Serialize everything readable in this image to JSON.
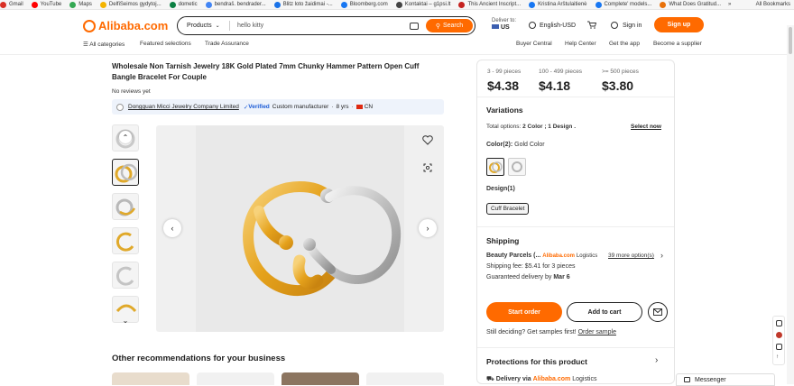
{
  "bookmarks": [
    {
      "label": "Gmail",
      "color": "#d93025"
    },
    {
      "label": "YouTube",
      "color": "#ff0000"
    },
    {
      "label": "Maps",
      "color": "#34a853"
    },
    {
      "label": "DelfiSeimos gydytoj...",
      "color": "#f4b400"
    },
    {
      "label": "dometic",
      "color": "#0b8043"
    },
    {
      "label": "bendraš. bendrader...",
      "color": "#4285f4"
    },
    {
      "label": "Blitz loto žaidimai -...",
      "color": "#1a73e8"
    },
    {
      "label": "Bloomberg.com",
      "color": "#1877f2"
    },
    {
      "label": "Kontaktai – g1psi.lt",
      "color": "#444444"
    },
    {
      "label": "This Ancient Inscript...",
      "color": "#c5221f"
    },
    {
      "label": "Kristina Arštulaitienė",
      "color": "#1877f2"
    },
    {
      "label": "Complete' models...",
      "color": "#1877f2"
    },
    {
      "label": "What Does Gratitud...",
      "color": "#e8710a"
    }
  ],
  "bookmarks_more": "»",
  "bookmarks_all": "All Bookmarks",
  "header": {
    "logo": "Alibaba.com",
    "search_category": "Products",
    "search_query": "hello kitty",
    "search_button": "Search",
    "deliver_to_label": "Deliver to:",
    "deliver_to_country": "US",
    "language": "English-USD",
    "sign_in": "Sign in",
    "sign_up": "Sign up"
  },
  "nav": {
    "all_categories": "All categories",
    "featured": "Featured selections",
    "trade_assurance": "Trade Assurance",
    "buyer_central": "Buyer Central",
    "help_center": "Help Center",
    "get_app": "Get the app",
    "become_supplier": "Become a supplier"
  },
  "product": {
    "title": "Wholesale Non Tarnish Jewelry 18K Gold Plated 7mm Chunky Hammer Pattern Open Cuff Bangle Bracelet For Couple",
    "reviews": "No reviews yet",
    "supplier_name": "Dongguan Micci Jewelry Company Limited",
    "verified": "Verified",
    "supplier_type": "Custom manufacturer",
    "years": "8 yrs",
    "country": "CN"
  },
  "pricing": [
    {
      "range": "3 - 99 pieces",
      "price": "$4.38"
    },
    {
      "range": "100 - 499 pieces",
      "price": "$4.18"
    },
    {
      "range": ">= 500 pieces",
      "price": "$3.80"
    }
  ],
  "variations": {
    "heading": "Variations",
    "total_label": "Total options:",
    "total_value": "2 Color ; 1 Design .",
    "select_now": "Select now",
    "color_label": "Color(2):",
    "color_value": "Gold Color",
    "design_label": "Design(1)",
    "design_option": "Cuff Bracelet"
  },
  "shipping": {
    "heading": "Shipping",
    "method": "Beauty Parcels (...",
    "logistics_brand": "Alibaba.com",
    "logistics_word": "Logistics",
    "more_options": "39 more option(s)",
    "fee": "Shipping fee: $5.41 for 3 pieces",
    "delivery_label": "Guaranteed delivery by",
    "delivery_date": "Mar 6"
  },
  "actions": {
    "start_order": "Start order",
    "add_to_cart": "Add to cart",
    "deciding": "Still deciding? Get samples first!",
    "order_sample": "Order sample"
  },
  "protection": {
    "heading": "Protections for this product",
    "delivery_via": "Delivery via",
    "brand": "Alibaba.com",
    "logistics": "Logistics"
  },
  "recommendations_title": "Other recommendations for your business",
  "messenger": "Messenger"
}
